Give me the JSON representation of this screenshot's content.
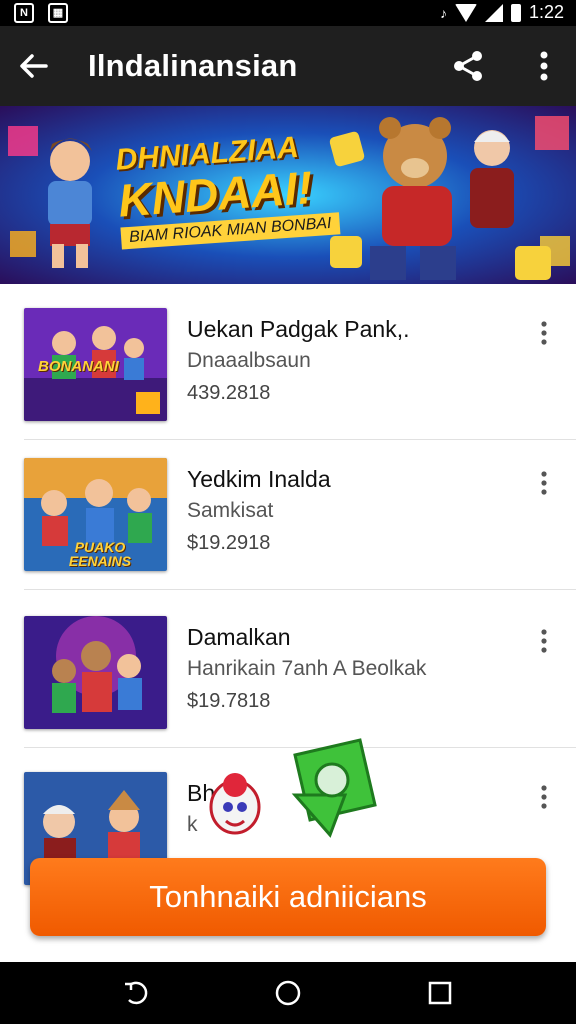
{
  "status_bar": {
    "time": "1:22"
  },
  "app_bar": {
    "title": "Ilndalinansian"
  },
  "banner": {
    "headline_line1": "DHNIALZIAA",
    "headline_line2": "KNDAAI!",
    "tagline": "BIAM RIOAK MIAN BONBAI"
  },
  "items": [
    {
      "title": "Uekan Padgak Pank,.",
      "subtitle": "Dnaaalbsaun",
      "price": "439.2818",
      "thumb_label": "BONANANI"
    },
    {
      "title": "Yedkim Inalda",
      "subtitle": "Samkisat",
      "price": "$19.2918",
      "thumb_label": "PUAKO EENAINS"
    },
    {
      "title": "Damalkan",
      "subtitle": "Hanrikain 7anh A Beolkak",
      "price": "$19.7818",
      "thumb_label": ""
    },
    {
      "title": "Bhc",
      "subtitle": "k",
      "price": "",
      "thumb_label": ""
    }
  ],
  "cta": {
    "label": "Tonhnaiki adniicians"
  },
  "icons": [
    "back-arrow-icon",
    "share-icon",
    "overflow-menu-icon",
    "item-menu-icon",
    "nav-back-icon",
    "nav-home-icon",
    "nav-recents-icon"
  ]
}
